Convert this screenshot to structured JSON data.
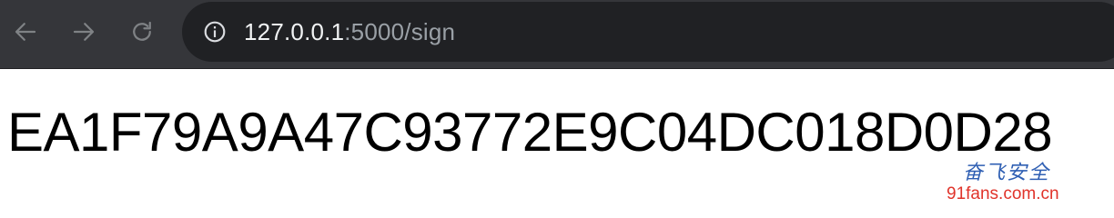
{
  "browser": {
    "url_host": "127.0.0.1",
    "url_rest": ":5000/sign",
    "icons": {
      "back": "arrow-left-icon",
      "forward": "arrow-right-icon",
      "reload": "reload-icon",
      "info": "info-circle-icon"
    }
  },
  "page": {
    "sign_value": "EA1F79A9A47C93772E9C04DC018D0D28"
  },
  "watermark": {
    "brand_chinese": "奋飞安全",
    "site": "91fans.com.cn"
  },
  "colors": {
    "toolbar": "#35363a",
    "omnibox": "#202124",
    "watermark_blue": "#2f5fb3",
    "watermark_red": "#e0332a"
  }
}
